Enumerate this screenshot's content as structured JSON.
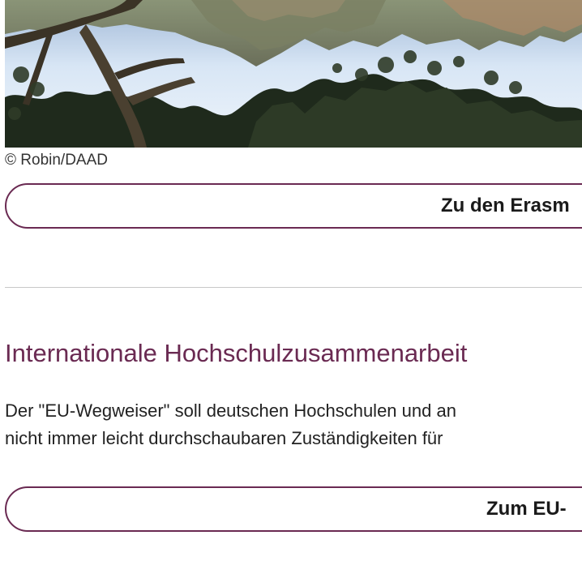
{
  "image": {
    "description_icon": "landscape-photo-icon",
    "credit": "© Robin/DAAD"
  },
  "erasmus_button": {
    "label": "Zu den Erasm"
  },
  "section": {
    "title": "Internationale Hochschulzusammenarbeit",
    "paragraph_line_1": "Der \"EU-Wegweiser\" soll deutschen Hochschulen und an",
    "paragraph_line_2": "nicht immer leicht durchschaubaren Zuständigkeiten für"
  },
  "eu_button": {
    "label": "Zum EU-"
  },
  "colors": {
    "accent": "#6a2a52",
    "divider": "#c8c8c8",
    "text": "#222222"
  }
}
